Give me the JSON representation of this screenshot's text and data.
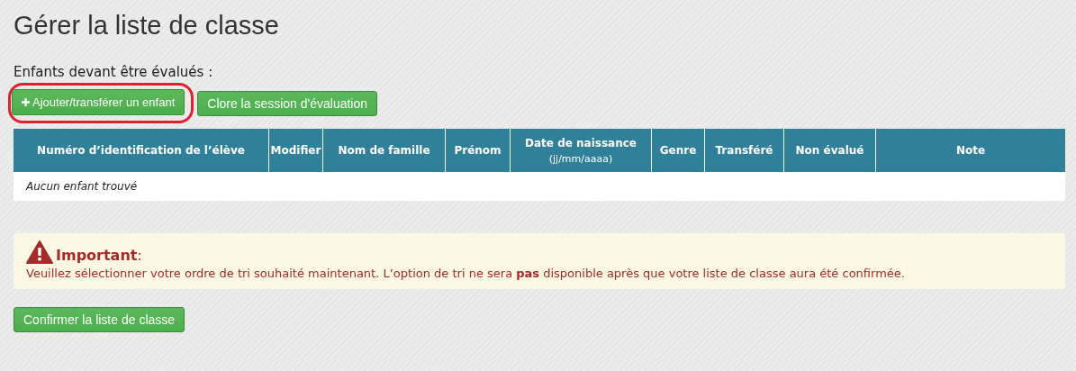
{
  "page_title": "Gérer la liste de classe",
  "section_label": "Enfants devant être évalués :",
  "actions": [
    {
      "label": "Ajouter/transférer un enfant",
      "kind": "add",
      "highlighted": true
    },
    {
      "label": "Clore la session d'évaluation",
      "kind": "close",
      "highlighted": false
    }
  ],
  "table": {
    "columns": [
      {
        "label": "Numéro d’identification de l’élève"
      },
      {
        "label": "Modifier"
      },
      {
        "label": "Nom de famille"
      },
      {
        "label": "Prénom"
      },
      {
        "label": "Date de naissance",
        "sublabel": "(jj/mm/aaaa)"
      },
      {
        "label": "Genre"
      },
      {
        "label": "Transféré"
      },
      {
        "label": "Non évalué"
      },
      {
        "label": "Note"
      }
    ],
    "empty_message": "Aucun enfant trouvé"
  },
  "alert": {
    "kind": "warning",
    "heading": "**Important**:",
    "message": "Veuillez sélectionner votre ordre de tri souhaité maintenant. L’option de tri ne sera **pas** disponible après que votre liste de classe aura été confirmée."
  },
  "confirm_button": "Confirmer la liste de classe"
}
